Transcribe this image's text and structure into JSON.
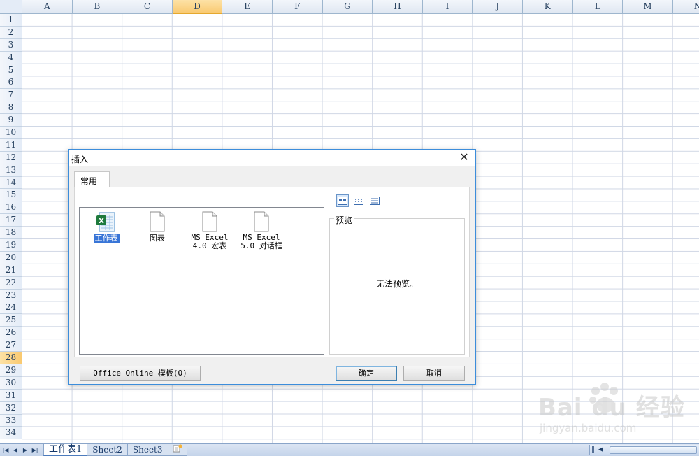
{
  "spreadsheet": {
    "columns": [
      "A",
      "B",
      "C",
      "D",
      "E",
      "F",
      "G",
      "H",
      "I",
      "J",
      "K",
      "L",
      "M",
      "N"
    ],
    "rows": [
      "1",
      "2",
      "3",
      "4",
      "5",
      "6",
      "7",
      "8",
      "9",
      "10",
      "11",
      "12",
      "13",
      "14",
      "15",
      "16",
      "17",
      "18",
      "19",
      "20",
      "21",
      "22",
      "23",
      "24",
      "25",
      "26",
      "27",
      "28",
      "29",
      "30",
      "31",
      "32",
      "33",
      "34"
    ],
    "selected_column": "D",
    "selected_row": "28"
  },
  "sheet_tabs": {
    "tabs": [
      "工作表1",
      "Sheet2",
      "Sheet3"
    ],
    "active": "工作表1"
  },
  "dialog": {
    "title": "插入",
    "tab_label": "常用",
    "templates": [
      {
        "label_lines": [
          "工作表"
        ],
        "icon": "excel-worksheet-icon",
        "selected": true
      },
      {
        "label_lines": [
          "图表"
        ],
        "icon": "blank-document-icon",
        "selected": false
      },
      {
        "label_lines": [
          "MS Excel",
          "4.0 宏表"
        ],
        "icon": "blank-document-icon",
        "selected": false
      },
      {
        "label_lines": [
          "MS Excel",
          "5.0 对话框"
        ],
        "icon": "blank-document-icon",
        "selected": false
      }
    ],
    "preview_label": "预览",
    "preview_message": "无法预览。",
    "online_button": "Office Online 模板(O)",
    "ok_button": "确定",
    "cancel_button": "取消"
  },
  "watermark": {
    "brand": "Bai du 经验",
    "url": "jingyan.baidu.com"
  },
  "colors": {
    "accent": "#3875d7",
    "dialog_border": "#3c8ddb",
    "header_bg": "#e4ecf7",
    "selected_header": "#f9c970"
  }
}
